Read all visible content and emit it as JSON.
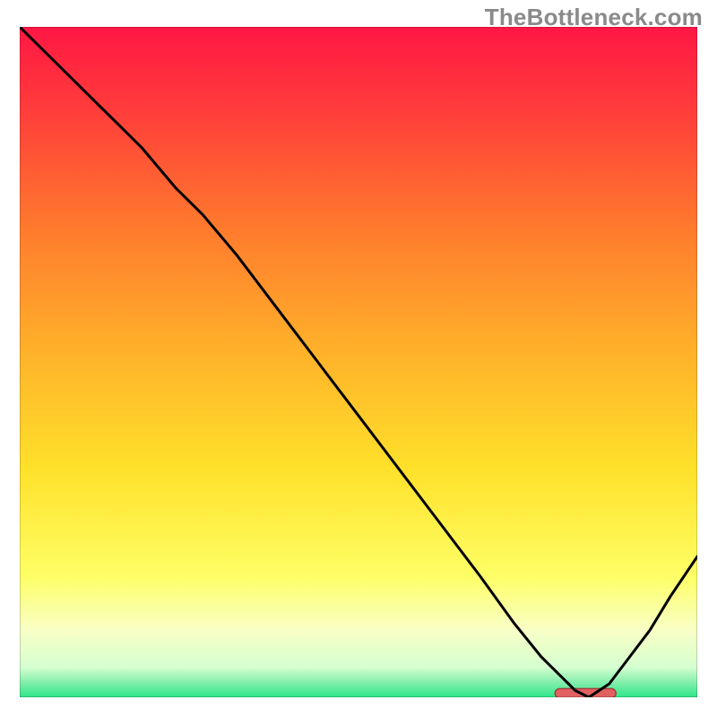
{
  "watermark": "TheBottleneck.com",
  "chart_data": {
    "type": "line",
    "title": "",
    "xlabel": "",
    "ylabel": "",
    "xlim": [
      0,
      100
    ],
    "ylim": [
      0,
      100
    ],
    "grid": false,
    "legend": false,
    "axes_visible": false,
    "background": {
      "type": "vertical-gradient",
      "stops": [
        {
          "pos": 0.0,
          "color": "#ff1744"
        },
        {
          "pos": 0.12,
          "color": "#ff3b3b"
        },
        {
          "pos": 0.3,
          "color": "#ff7a2d"
        },
        {
          "pos": 0.48,
          "color": "#ffb02a"
        },
        {
          "pos": 0.66,
          "color": "#ffe12a"
        },
        {
          "pos": 0.82,
          "color": "#feff66"
        },
        {
          "pos": 0.9,
          "color": "#f8ffc6"
        },
        {
          "pos": 0.955,
          "color": "#d6ffd0"
        },
        {
          "pos": 0.975,
          "color": "#8ef0b0"
        },
        {
          "pos": 1.0,
          "color": "#2de68a"
        }
      ]
    },
    "series": [
      {
        "name": "bottleneck-curve",
        "color": "#000000",
        "x": [
          0,
          6,
          12,
          18,
          23,
          27,
          32,
          38,
          44,
          50,
          56,
          62,
          68,
          73,
          77,
          80,
          82,
          84,
          87,
          90,
          93,
          96,
          100
        ],
        "y": [
          100,
          94,
          88,
          82,
          76,
          72,
          66,
          58,
          50,
          42,
          34,
          26,
          18,
          11,
          6,
          3,
          1,
          0,
          2,
          6,
          10,
          15,
          21
        ]
      }
    ],
    "annotations": [
      {
        "name": "min-marker",
        "shape": "rounded-rect",
        "x_range": [
          79,
          88
        ],
        "y": 0.6,
        "fill": "#e16060",
        "stroke": "#a03a3a"
      }
    ]
  }
}
